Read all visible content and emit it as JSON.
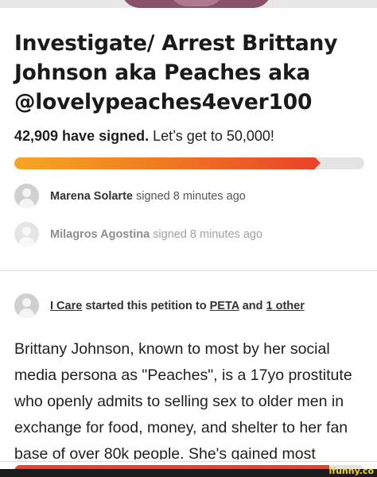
{
  "petition": {
    "title": "Investigate/ Arrest Brittany Johnson aka Peaches aka @lovelypeaches4ever100",
    "signature_count": "42,909 have signed.",
    "goal_text": "Let’s get to 50,000!",
    "progress_fraction": 0.858
  },
  "recent_signers": [
    {
      "name": "Marena Solarte",
      "action": "signed 8 minutes ago"
    },
    {
      "name": "Milagros Agostina",
      "action": "signed 8 minutes ago"
    }
  ],
  "starter": {
    "name": "I Care",
    "text_1": "started this petition to",
    "target": "PETA",
    "text_2": "and",
    "others": "1 other"
  },
  "body_text": "Brittany Johnson, known to most by her social media persona as \"Peaches\", is a 17yo prostitute who openly admits to selling sex to older men in exchange for food, money, and shelter to her fan base of over 80k people. She's gained most",
  "watermark": "ifunny.co",
  "colors": {
    "progress_start": "#f5a623",
    "progress_end": "#e8442a",
    "track": "#e3e3e3",
    "watermark": "#f7d51d"
  },
  "icons": {
    "avatar": "default-user-avatar-icon"
  }
}
